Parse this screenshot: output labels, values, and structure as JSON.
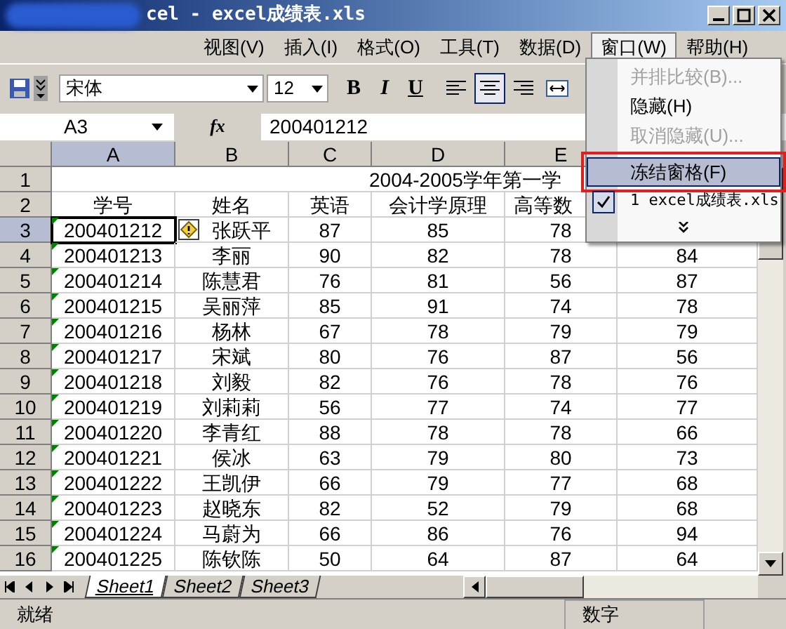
{
  "window": {
    "title": "cel - excel成绩表.xls"
  },
  "menu_bar": [
    {
      "label": "视图(V)",
      "selected": false
    },
    {
      "label": "插入(I)",
      "selected": false
    },
    {
      "label": "格式(O)",
      "selected": false
    },
    {
      "label": "工具(T)",
      "selected": false
    },
    {
      "label": "数据(D)",
      "selected": false
    },
    {
      "label": "窗口(W)",
      "selected": true
    },
    {
      "label": "帮助(H)",
      "selected": false
    }
  ],
  "window_menu": [
    {
      "kind": "item",
      "label": "并排比较(B)...",
      "disabled": true,
      "selected": false,
      "checked": false,
      "annotated": false
    },
    {
      "kind": "item",
      "label": "隐藏(H)",
      "disabled": false,
      "selected": false,
      "checked": false,
      "annotated": false
    },
    {
      "kind": "item",
      "label": "取消隐藏(U)...",
      "disabled": true,
      "selected": false,
      "checked": false,
      "annotated": false
    },
    {
      "kind": "separator"
    },
    {
      "kind": "item",
      "label": "冻结窗格(F)",
      "disabled": false,
      "selected": true,
      "checked": false,
      "annotated": true
    },
    {
      "kind": "file",
      "label": "1 excel成绩表.xls",
      "disabled": false,
      "selected": false,
      "checked": true,
      "annotated": false
    },
    {
      "kind": "expand",
      "selected": false
    }
  ],
  "toolbar": {
    "font": "宋体",
    "size": "12",
    "styles": [
      "B",
      "I",
      "U"
    ],
    "align": [
      {
        "kind": "left",
        "selected": false
      },
      {
        "kind": "center",
        "selected": true
      },
      {
        "kind": "right",
        "selected": false
      },
      {
        "kind": "merge",
        "selected": false
      }
    ]
  },
  "formula_bar": {
    "name_box": "A3",
    "fx": "fx",
    "value": "200401212"
  },
  "sheet": {
    "columns": [
      {
        "label": "A",
        "selected": true
      },
      {
        "label": "B",
        "selected": false
      },
      {
        "label": "C",
        "selected": false
      },
      {
        "label": "D",
        "selected": false
      },
      {
        "label": "E",
        "selected": false
      }
    ],
    "title_row": {
      "header": "1",
      "title": "2004-2005学年第一学"
    },
    "rows": [
      {
        "header": "2",
        "selected": false,
        "cells": [
          "学号",
          "姓名",
          "英语",
          "会计学原理",
          "高等数"
        ]
      },
      {
        "header": "3",
        "selected": true,
        "text_number": true,
        "active": true,
        "smart_tag": true,
        "cells": [
          "200401212",
          "张跃平",
          "87",
          "85",
          "78"
        ]
      },
      {
        "header": "4",
        "selected": false,
        "text_number": true,
        "cells": [
          "200401213",
          "李丽",
          "90",
          "82",
          "78",
          "84"
        ]
      },
      {
        "header": "5",
        "selected": false,
        "text_number": true,
        "cells": [
          "200401214",
          "陈慧君",
          "76",
          "81",
          "56",
          "87"
        ]
      },
      {
        "header": "6",
        "selected": false,
        "text_number": true,
        "cells": [
          "200401215",
          "吴丽萍",
          "85",
          "91",
          "74",
          "78"
        ]
      },
      {
        "header": "7",
        "selected": false,
        "text_number": true,
        "cells": [
          "200401216",
          "杨林",
          "67",
          "78",
          "79",
          "79"
        ]
      },
      {
        "header": "8",
        "selected": false,
        "text_number": true,
        "cells": [
          "200401217",
          "宋斌",
          "80",
          "76",
          "87",
          "56"
        ]
      },
      {
        "header": "9",
        "selected": false,
        "text_number": true,
        "cells": [
          "200401218",
          "刘毅",
          "82",
          "76",
          "78",
          "76"
        ]
      },
      {
        "header": "10",
        "selected": false,
        "text_number": true,
        "cells": [
          "200401219",
          "刘莉莉",
          "56",
          "77",
          "74",
          "77"
        ]
      },
      {
        "header": "11",
        "selected": false,
        "text_number": true,
        "cells": [
          "200401220",
          "李青红",
          "88",
          "78",
          "78",
          "66"
        ]
      },
      {
        "header": "12",
        "selected": false,
        "text_number": true,
        "cells": [
          "200401221",
          "侯冰",
          "63",
          "79",
          "80",
          "73"
        ]
      },
      {
        "header": "13",
        "selected": false,
        "text_number": true,
        "cells": [
          "200401222",
          "王凯伊",
          "66",
          "79",
          "77",
          "68"
        ]
      },
      {
        "header": "14",
        "selected": false,
        "text_number": true,
        "cells": [
          "200401223",
          "赵晓东",
          "82",
          "52",
          "79",
          "68"
        ]
      },
      {
        "header": "15",
        "selected": false,
        "text_number": true,
        "cells": [
          "200401224",
          "马蔚为",
          "66",
          "86",
          "76",
          "94"
        ]
      },
      {
        "header": "16",
        "selected": false,
        "text_number": true,
        "cells": [
          "200401225",
          "陈钦陈",
          "50",
          "64",
          "87",
          "64"
        ]
      }
    ]
  },
  "sheet_tabs": [
    {
      "label": "Sheet1",
      "selected": true
    },
    {
      "label": "Sheet2",
      "selected": false
    },
    {
      "label": "Sheet3",
      "selected": false
    }
  ],
  "status_bar": {
    "state": "就绪",
    "mode": "数字"
  }
}
